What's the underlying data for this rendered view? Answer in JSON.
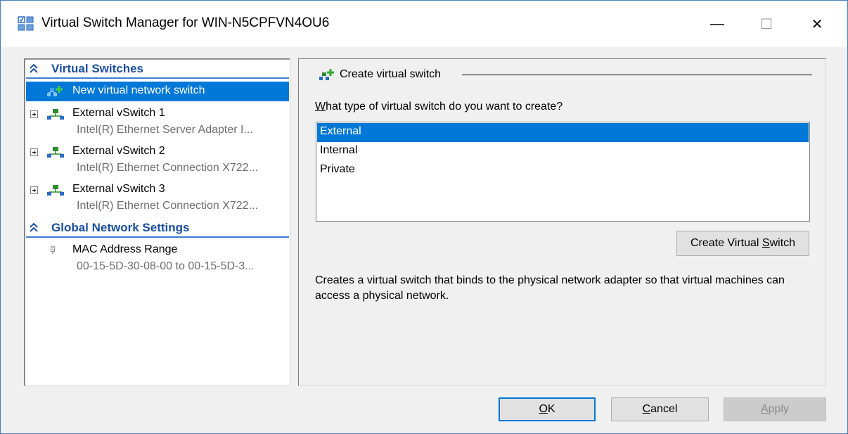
{
  "window": {
    "title": "Virtual Switch Manager for WIN-N5CPFVN4OU6",
    "title_icon": "virtual-switch-manager-icon",
    "minimize_glyph": "—",
    "maximize_glyph": "☐",
    "close_glyph": "✕"
  },
  "left_panel": {
    "sections": [
      {
        "label": "Virtual Switches",
        "icon": "collapse-chevron-icon",
        "items": [
          {
            "label": "New virtual network switch",
            "selected": true,
            "icon": "new-switch-icon"
          },
          {
            "label": "External vSwitch 1",
            "sub": "Intel(R) Ethernet Server Adapter I...",
            "icon": "network-switch-icon",
            "expander": "+"
          },
          {
            "label": "External vSwitch 2",
            "sub": "Intel(R) Ethernet Connection X722...",
            "icon": "network-switch-icon",
            "expander": "+"
          },
          {
            "label": "External vSwitch 3",
            "sub": "Intel(R) Ethernet Connection X722...",
            "icon": "network-switch-icon",
            "expander": "+"
          }
        ]
      },
      {
        "label": "Global Network Settings",
        "icon": "collapse-chevron-icon",
        "items": [
          {
            "label": "MAC Address Range",
            "sub": "00-15-5D-30-08-00 to 00-15-5D-3...",
            "icon": "mac-address-icon"
          }
        ]
      }
    ]
  },
  "right_panel": {
    "group_title": "Create virtual switch",
    "question_prefix": "W",
    "question_rest": "hat type of virtual switch do you want to create?",
    "switch_types": [
      "External",
      "Internal",
      "Private"
    ],
    "selected_type": "External",
    "create_button_prefix": "Create Virtual ",
    "create_button_access": "S",
    "create_button_suffix": "witch",
    "description": "Creates a virtual switch that binds to the physical network adapter so that virtual machines can access a physical network."
  },
  "footer": {
    "ok_access": "O",
    "ok_rest": "K",
    "cancel_access": "C",
    "cancel_rest": "ancel",
    "apply_access": "A",
    "apply_rest": "pply"
  },
  "colors": {
    "selection": "#0078d7",
    "section_header": "#1a4fa0",
    "section_underline": "#3c7fd0",
    "muted_text": "#6d6d6d"
  }
}
